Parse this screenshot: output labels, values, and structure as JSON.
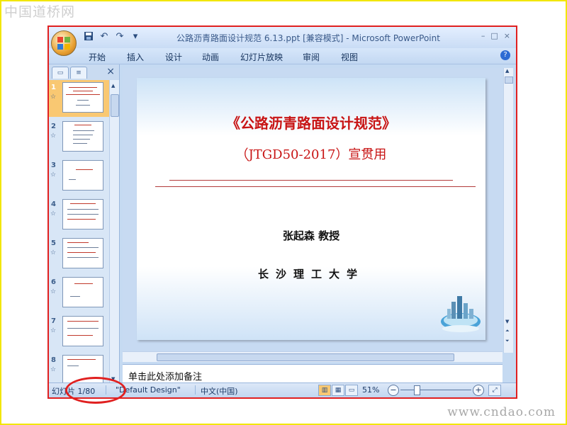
{
  "watermarks": {
    "top": "中国道桥网",
    "bottom": "www.cndao.com"
  },
  "window": {
    "title": "公路沥青路面设计规范 6.13.ppt [兼容模式] - Microsoft PowerPoint",
    "controls": {
      "minimize": "–",
      "maximize": "□",
      "close": "×"
    }
  },
  "quick_access": {
    "save_icon": "save-icon",
    "undo_icon": "undo-icon",
    "redo_icon": "redo-icon",
    "customize_icon": "dropdown-icon"
  },
  "ribbon": {
    "tabs": [
      "开始",
      "插入",
      "设计",
      "动画",
      "幻灯片放映",
      "审阅",
      "视图"
    ],
    "help_label": "?"
  },
  "outline_pane": {
    "tab_slides_icon": "slides-tab-icon",
    "tab_outline_icon": "outline-tab-icon",
    "close_label": "×",
    "thumbnails": [
      {
        "number": "1",
        "active": true
      },
      {
        "number": "2",
        "active": false
      },
      {
        "number": "3",
        "active": false
      },
      {
        "number": "4",
        "active": false
      },
      {
        "number": "5",
        "active": false
      },
      {
        "number": "6",
        "active": false
      },
      {
        "number": "7",
        "active": false
      },
      {
        "number": "8",
        "active": false
      }
    ]
  },
  "slide": {
    "title": "《公路沥青路面设计规范》",
    "subtitle": "（JTGD50-2017）宣贯用",
    "author": "张起森 教授",
    "school": "长沙理工大学"
  },
  "notes": {
    "placeholder": "单击此处添加备注"
  },
  "statusbar": {
    "slide_position": "幻灯片 1/80",
    "theme": "\"Default Design\"",
    "language": "中文(中国)",
    "zoom": "51%",
    "zoom_minus": "−",
    "zoom_plus": "+"
  },
  "colors": {
    "accent_red": "#c81414",
    "annotation_red": "#e02020",
    "frame_yellow": "#f2e600",
    "ribbon_blue": "#c3d8f2"
  }
}
